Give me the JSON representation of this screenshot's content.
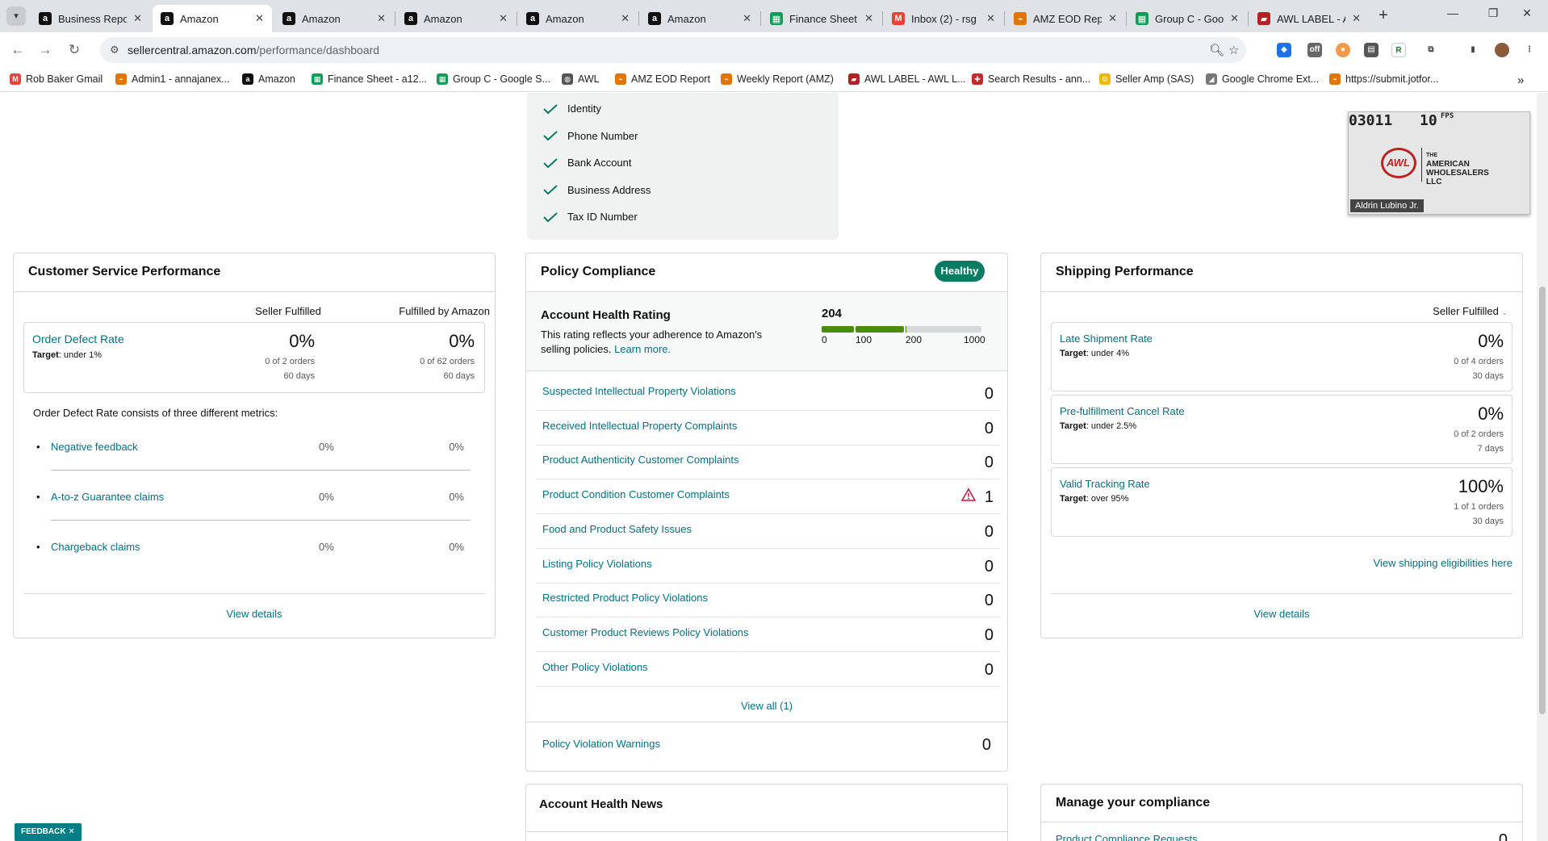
{
  "browser": {
    "tabs": [
      {
        "title": "Business Repo",
        "icon": "amazon-icon"
      },
      {
        "title": "Amazon",
        "icon": "amazon-icon"
      },
      {
        "title": "Amazon",
        "icon": "amazon-icon"
      },
      {
        "title": "Amazon",
        "icon": "amazon-icon"
      },
      {
        "title": "Amazon",
        "icon": "amazon-icon"
      },
      {
        "title": "Amazon",
        "icon": "amazon-icon"
      },
      {
        "title": "Finance Sheet",
        "icon": "sheets-icon"
      },
      {
        "title": "Inbox (2) - rsg",
        "icon": "gmail-icon"
      },
      {
        "title": "AMZ EOD Rep",
        "icon": "report-icon"
      },
      {
        "title": "Group C - Goo",
        "icon": "sheets-icon"
      },
      {
        "title": "AWL LABEL - A",
        "icon": "awl-icon"
      }
    ],
    "active_tab": 1,
    "url_host": "sellercentral.amazon.com",
    "url_path": "/performance/dashboard",
    "bookmarks": [
      {
        "label": "Rob Baker Gmail",
        "icon": "gmail-icon"
      },
      {
        "label": "Admin1 - annajanex...",
        "icon": "report-icon"
      },
      {
        "label": "Amazon",
        "icon": "amazon-icon"
      },
      {
        "label": "Finance Sheet - a12...",
        "icon": "sheets-icon"
      },
      {
        "label": "Group C - Google S...",
        "icon": "sheets-icon"
      },
      {
        "label": "AWL",
        "icon": "globe-icon"
      },
      {
        "label": "AMZ EOD Report",
        "icon": "report-icon"
      },
      {
        "label": "Weekly Report (AMZ)",
        "icon": "report-icon"
      },
      {
        "label": "AWL LABEL - AWL L...",
        "icon": "awl-icon"
      },
      {
        "label": "Search Results - ann...",
        "icon": "search-results-icon"
      },
      {
        "label": "Seller Amp (SAS)",
        "icon": "selleramp-icon"
      },
      {
        "label": "Google Chrome Ext...",
        "icon": "chrome-icon"
      },
      {
        "label": "https://submit.jotfor...",
        "icon": "report-icon"
      }
    ]
  },
  "verification": {
    "items": [
      "Identity",
      "Phone Number",
      "Bank Account",
      "Business Address",
      "Tax ID Number"
    ]
  },
  "video": {
    "timer": "03011",
    "fps_value": "10",
    "fps_label": "FPS",
    "logo_text": "AMERICAN WHOLESALERS LLC",
    "logo_prefix": "THE",
    "logo_short": "AWL",
    "presenter": "Aldrin Lubino Jr."
  },
  "customer_service": {
    "title": "Customer Service Performance",
    "col_seller": "Seller Fulfilled",
    "col_fba": "Fulfilled by Amazon",
    "odr": {
      "label": "Order Defect Rate",
      "target_label": "Target",
      "target_value": ": under 1%",
      "seller_pct": "0%",
      "seller_orders": "0 of 2 orders",
      "seller_days": "60 days",
      "fba_pct": "0%",
      "fba_orders": "0 of 62 orders",
      "fba_days": "60 days"
    },
    "metrics_intro": "Order Defect Rate consists of three different metrics:",
    "metrics": [
      {
        "label": "Negative feedback",
        "seller": "0%",
        "fba": "0%"
      },
      {
        "label": "A-to-z Guarantee claims",
        "seller": "0%",
        "fba": "0%"
      },
      {
        "label": "Chargeback claims",
        "seller": "0%",
        "fba": "0%"
      }
    ],
    "view_details": "View details"
  },
  "policy": {
    "title": "Policy Compliance",
    "status": "Healthy",
    "ahr_title": "Account Health Rating",
    "ahr_desc": "This rating reflects your adherence to Amazon's selling policies.",
    "learn_more": "Learn more.",
    "score": "204",
    "score_value": 204,
    "scale_labels": [
      "0",
      "100",
      "200",
      "1000"
    ],
    "rows": [
      {
        "label": "Suspected Intellectual Property Violations",
        "value": "0",
        "warning": false
      },
      {
        "label": "Received Intellectual Property Complaints",
        "value": "0",
        "warning": false
      },
      {
        "label": "Product Authenticity Customer Complaints",
        "value": "0",
        "warning": false
      },
      {
        "label": "Product Condition Customer Complaints",
        "value": "1",
        "warning": true
      },
      {
        "label": "Food and Product Safety Issues",
        "value": "0",
        "warning": false
      },
      {
        "label": "Listing Policy Violations",
        "value": "0",
        "warning": false
      },
      {
        "label": "Restricted Product Policy Violations",
        "value": "0",
        "warning": false
      },
      {
        "label": "Customer Product Reviews Policy Violations",
        "value": "0",
        "warning": false
      },
      {
        "label": "Other Policy Violations",
        "value": "0",
        "warning": false
      }
    ],
    "view_all": "View all (1)",
    "warnings_label": "Policy Violation Warnings",
    "warnings_value": "0"
  },
  "shipping": {
    "title": "Shipping Performance",
    "filter": "Seller Fulfilled",
    "metrics": [
      {
        "label": "Late Shipment Rate",
        "target_label": "Target",
        "target_value": ": under 4%",
        "pct": "0%",
        "orders": "0 of 4 orders",
        "days": "30 days"
      },
      {
        "label": "Pre-fulfillment Cancel Rate",
        "target_label": "Target",
        "target_value": ": under 2.5%",
        "pct": "0%",
        "orders": "0 of 2 orders",
        "days": "7 days"
      },
      {
        "label": "Valid Tracking Rate",
        "target_label": "Target",
        "target_value": ": over 95%",
        "pct": "100%",
        "orders": "1 of 1 orders",
        "days": "30 days"
      }
    ],
    "eligibility_link": "View shipping eligibilities here",
    "view_details": "View details"
  },
  "news": {
    "title": "Account Health News"
  },
  "compliance": {
    "title": "Manage your compliance",
    "link": "Product Compliance Requests",
    "value": "0"
  },
  "feedback": {
    "label": "FEEDBACK",
    "close": "✕"
  },
  "colors": {
    "link": "#007185",
    "healthy": "#067d62",
    "bar_green": "#4c8c0c",
    "warning": "#cc0c39"
  }
}
